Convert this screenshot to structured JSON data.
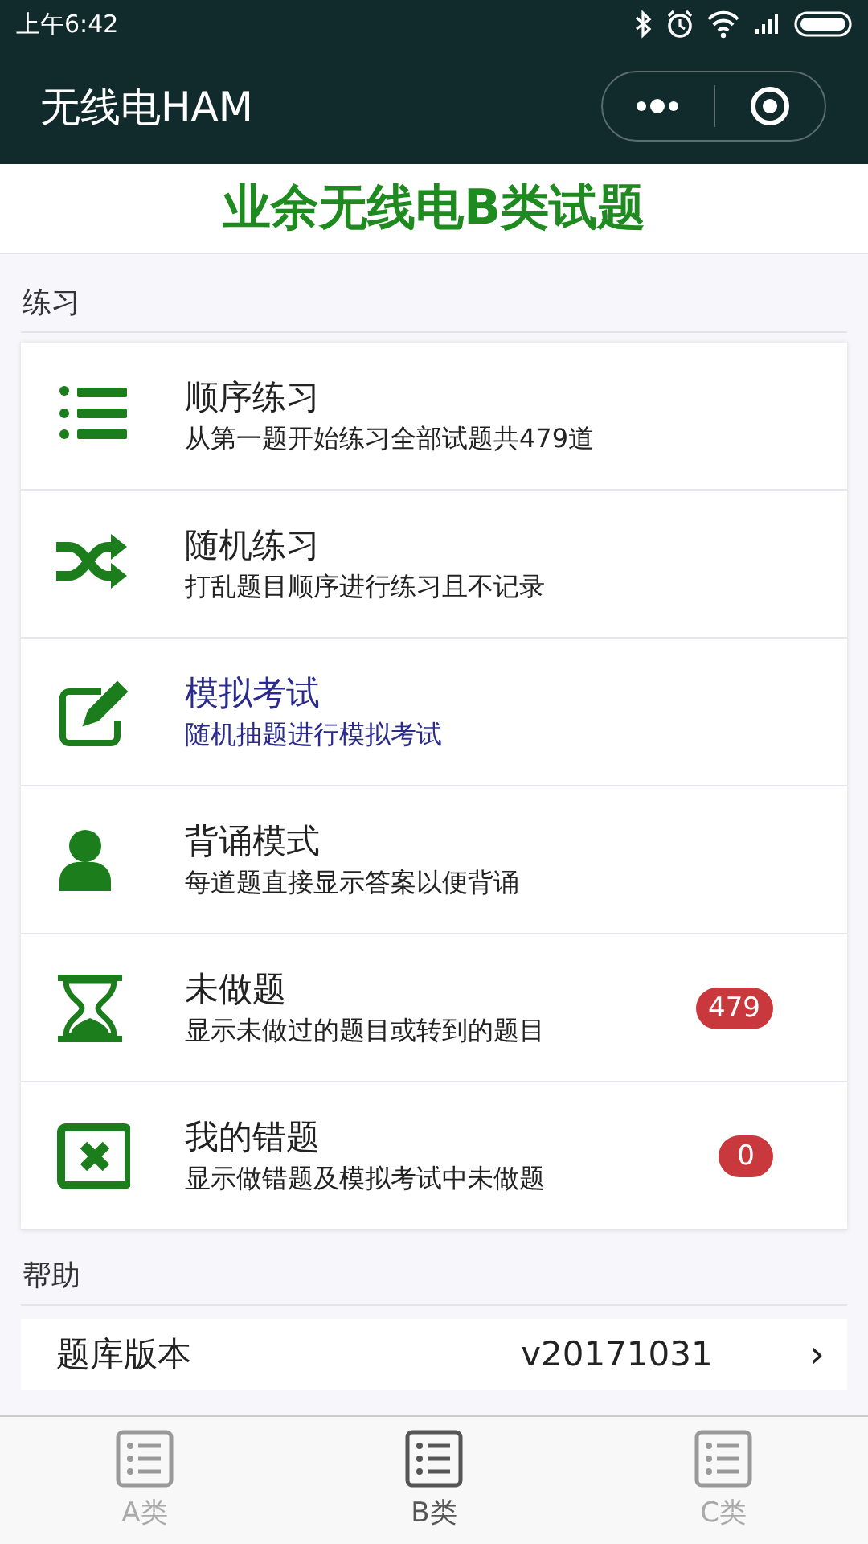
{
  "status_bar": {
    "time": "上午6:42"
  },
  "header": {
    "title": "无线电HAM"
  },
  "page_title": "业余无线电B类试题",
  "practice": {
    "heading": "练习",
    "items": [
      {
        "kind": "ordered",
        "title": "顺序练习",
        "subtitle": "从第一题开始练习全部试题共479道",
        "highlighted": false
      },
      {
        "kind": "shuffle",
        "title": "随机练习",
        "subtitle": "打乱题目顺序进行练习且不记录",
        "highlighted": false
      },
      {
        "kind": "edit",
        "title": "模拟考试",
        "subtitle": "随机抽题进行模拟考试",
        "highlighted": true
      },
      {
        "kind": "person",
        "title": "背诵模式",
        "subtitle": "每道题直接显示答案以便背诵",
        "highlighted": false
      },
      {
        "kind": "hourglass",
        "title": "未做题",
        "subtitle": "显示未做过的题目或转到的题目",
        "highlighted": false,
        "badge": "479"
      },
      {
        "kind": "wrong",
        "title": "我的错题",
        "subtitle": "显示做错题及模拟考试中未做题",
        "highlighted": false,
        "badge": "0"
      }
    ]
  },
  "help": {
    "heading": "帮助",
    "items": [
      {
        "label": "题库版本",
        "value": "v20171031",
        "chevron": "›"
      }
    ]
  },
  "tabs": [
    {
      "label": "A类",
      "selected": false
    },
    {
      "label": "B类",
      "selected": true
    },
    {
      "label": "C类",
      "selected": false
    }
  ]
}
